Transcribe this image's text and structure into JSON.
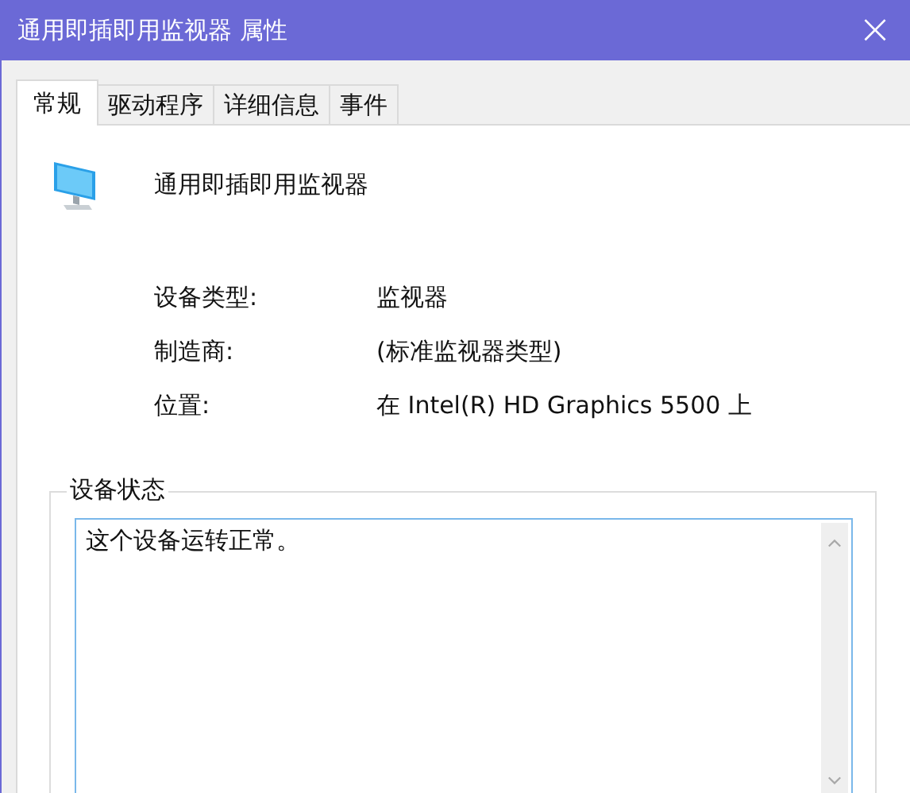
{
  "window": {
    "title": "通用即插即用监视器 属性",
    "close": "×"
  },
  "tabs": [
    {
      "label": "常规",
      "selected": true
    },
    {
      "label": "驱动程序",
      "selected": false
    },
    {
      "label": "详细信息",
      "selected": false
    },
    {
      "label": "事件",
      "selected": false
    }
  ],
  "device": {
    "name": "通用即插即用监视器"
  },
  "properties": [
    {
      "label": "设备类型:",
      "value": "监视器"
    },
    {
      "label": "制造商:",
      "value": "(标准监视器类型)"
    },
    {
      "label": "位置:",
      "value": "在 Intel(R) HD Graphics 5500 上"
    }
  ],
  "status_group": {
    "title": "设备状态",
    "text": "这个设备运转正常。"
  }
}
